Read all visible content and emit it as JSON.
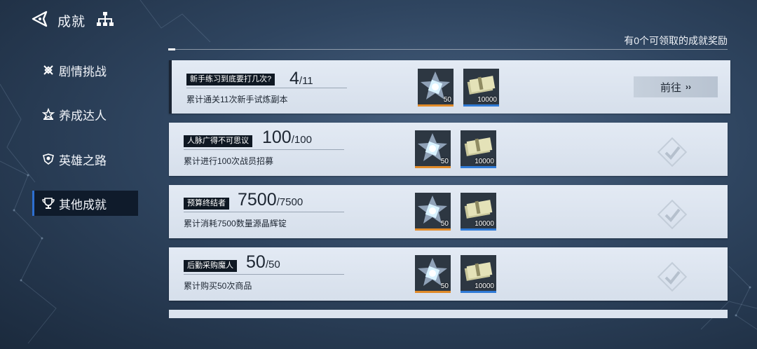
{
  "header": {
    "title": "成就",
    "reward_note": "有0个可领取的成就奖励"
  },
  "sidebar": {
    "items": [
      {
        "label": "剧情挑战",
        "icon": "cross-swords-icon",
        "active": false
      },
      {
        "label": "养成达人",
        "icon": "star-crown-icon",
        "active": false
      },
      {
        "label": "英雄之路",
        "icon": "shield-emblem-icon",
        "active": false
      },
      {
        "label": "其他成就",
        "icon": "trophy-icon",
        "active": true
      }
    ]
  },
  "achievements": [
    {
      "name": "新手练习到底要打几次?",
      "current": "4",
      "total": "/11",
      "desc": "累计通关11次新手试炼副本",
      "rewards": [
        {
          "icon": "crystal-star-icon",
          "qty": "50"
        },
        {
          "icon": "cash-bundle-icon",
          "qty": "10000"
        }
      ],
      "status": "go",
      "go_label": "前往",
      "go_arrows": "››"
    },
    {
      "name": "人脉广得不可思议",
      "current": "100",
      "total": "/100",
      "desc": "累计进行100次战员招募",
      "rewards": [
        {
          "icon": "crystal-star-icon",
          "qty": "50"
        },
        {
          "icon": "cash-bundle-icon",
          "qty": "10000"
        }
      ],
      "status": "claimed"
    },
    {
      "name": "预算终结者",
      "current": "7500",
      "total": "/7500",
      "desc": "累计消耗7500数量源晶辉锭",
      "rewards": [
        {
          "icon": "crystal-star-icon",
          "qty": "50"
        },
        {
          "icon": "cash-bundle-icon",
          "qty": "10000"
        }
      ],
      "status": "claimed"
    },
    {
      "name": "后勤采购魔人",
      "current": "50",
      "total": "/50",
      "desc": "累计购买50次商品",
      "rewards": [
        {
          "icon": "crystal-star-icon",
          "qty": "50"
        },
        {
          "icon": "cash-bundle-icon",
          "qty": "10000"
        }
      ],
      "status": "claimed"
    }
  ],
  "colors": {
    "accent_blue": "#2f7ad6",
    "accent_orange": "#e08a28",
    "card_bg": "#dfe6f0"
  }
}
